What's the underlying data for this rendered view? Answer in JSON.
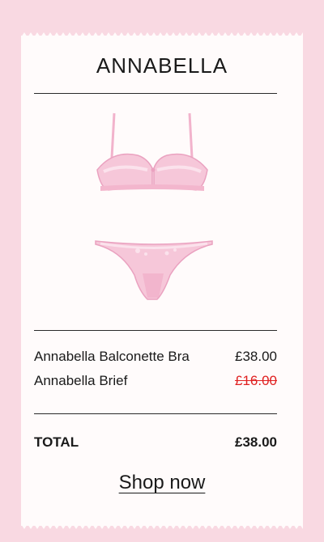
{
  "card": {
    "title": "ANNABELLA",
    "image_alt": "Annabella bra and brief"
  },
  "items": [
    {
      "name": "Annabella Balconette Bra",
      "price": "£38.00",
      "strikethrough": false
    },
    {
      "name": "Annabella Brief",
      "price": "£16.00",
      "strikethrough": true
    }
  ],
  "total": {
    "label": "TOTAL",
    "value": "£38.00"
  },
  "cta": {
    "label": "Shop now"
  },
  "colors": {
    "background": "#f9d9e2",
    "card": "#fffbfb",
    "strike": "#e02020",
    "garment": "#f4b8d0"
  }
}
